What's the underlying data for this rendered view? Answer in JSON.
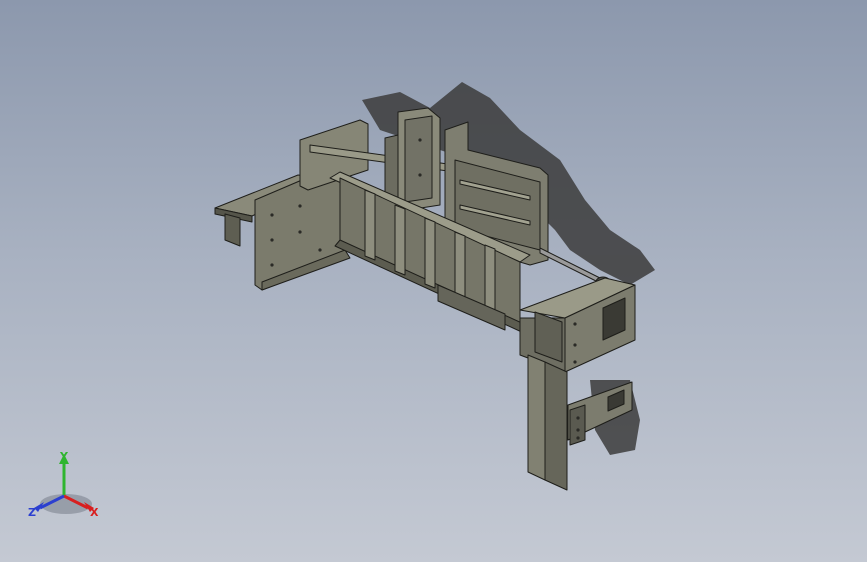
{
  "view": {
    "background_top": "#8c98ad",
    "background_bottom": "#c4c9d3",
    "model_color": "#7a7a6c",
    "shadow_color": "#3a3a3a"
  },
  "triad": {
    "x_label": "X",
    "y_label": "Y",
    "z_label": "Z",
    "x_color": "#d81f1f",
    "y_color": "#2fb52f",
    "z_color": "#2b3fd0",
    "icon": "coordinate-triad-icon"
  }
}
